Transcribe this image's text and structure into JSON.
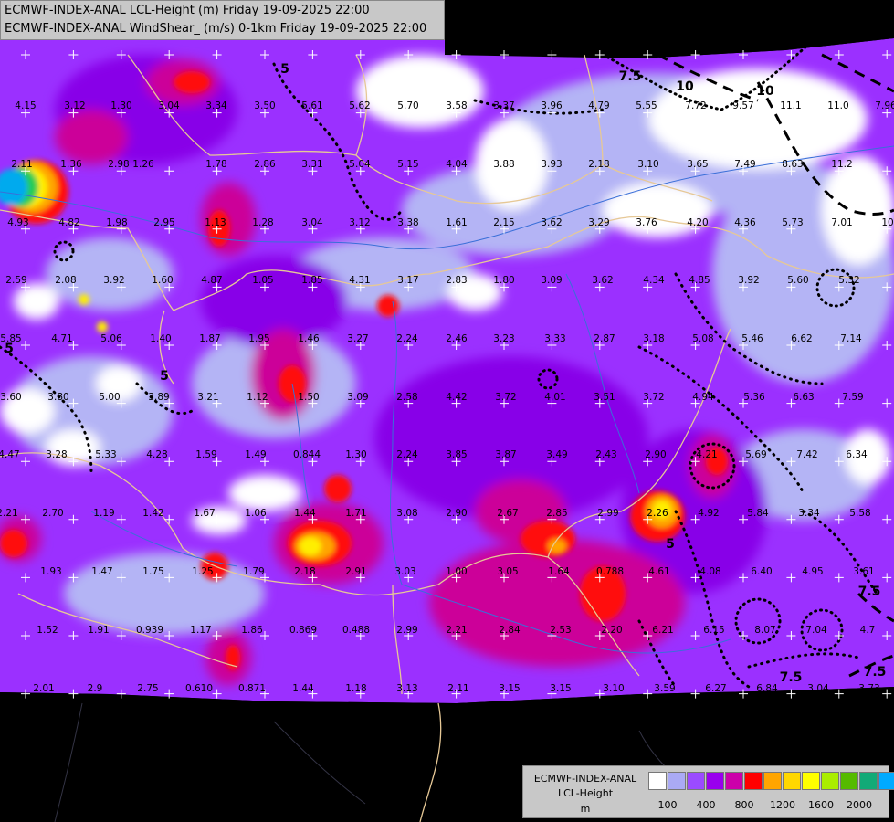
{
  "header": {
    "line1": "ECMWF-INDEX-ANAL LCL-Height (m) Friday 19-09-2025 22:00",
    "line2": "ECMWF-INDEX-ANAL WindShear_ (m/s) 0-1km Friday 19-09-2025 22:00"
  },
  "legend": {
    "title1": "ECMWF-INDEX-ANAL",
    "title2": "LCL-Height",
    "title3": "m",
    "colors": [
      "#ffffff",
      "#aaaaf5",
      "#9b4bff",
      "#9900ee",
      "#cc00aa",
      "#ff0000",
      "#ffa500",
      "#ffd700",
      "#ffff00",
      "#aaee00",
      "#55bb00",
      "#11aa77",
      "#00aaff"
    ],
    "ticks": [
      "100",
      "400",
      "800",
      "1200",
      "1600",
      "2000"
    ]
  },
  "palette": {
    "background": "#000000",
    "base_field": "#9b30ff",
    "low": "#ffffff",
    "light": "#b4b4f5",
    "medium": "#c3a0ff",
    "dark": "#8800e8",
    "magenta": "#cc0099",
    "red": "#ff1010",
    "orange": "#ffa500",
    "yellow": "#ffee00",
    "green": "#22cc55",
    "cyan": "#00aaee",
    "border": "#e6c896",
    "river": "#3a6fd8"
  },
  "contour_labels": [
    "7.5",
    "10",
    "10",
    "5",
    "5",
    "5",
    "7.5",
    "7.5",
    "5",
    "7.5"
  ],
  "values": [
    "4.15",
    "3.12",
    "1.30",
    "3.04",
    "3.34",
    "3.50",
    "5.61",
    "5.62",
    "5.70",
    "3.58",
    "3.37",
    "3.96",
    "4.79",
    "5.55",
    "7.72",
    "9.57",
    "11.1",
    "11.0",
    "7.96",
    "2.11",
    "1.36",
    "2.98",
    "1.26",
    "1.78",
    "2.86",
    "3.31",
    "5.04",
    "5.15",
    "4.04",
    "3.88",
    "3.93",
    "2.18",
    "3.10",
    "3.65",
    "7.49",
    "8.63",
    "11.2",
    "4.93",
    "4.82",
    "1.98",
    "2.95",
    "1.13",
    "1.28",
    "3.04",
    "3.12",
    "3.38",
    "1.61",
    "2.15",
    "3.62",
    "3.29",
    "3.76",
    "4.20",
    "4.36",
    "5.73",
    "7.01",
    "10",
    "2.59",
    "2.08",
    "3.92",
    "1.60",
    "4.87",
    "1.05",
    "1.85",
    "4.31",
    "3.17",
    "2.83",
    "1.80",
    "3.09",
    "3.62",
    "4.34",
    "4.85",
    "3.92",
    "5.60",
    "5.32",
    "5.85",
    "4.71",
    "5.06",
    "1.40",
    "1.87",
    "1.95",
    "1.46",
    "3.27",
    "2.24",
    "2.46",
    "3.23",
    "3.33",
    "2.87",
    "3.18",
    "5.08",
    "5.46",
    "6.62",
    "7.14",
    "3.60",
    "3.80",
    "5.00",
    "3.89",
    "3.21",
    "1.12",
    "1.50",
    "3.09",
    "2.58",
    "4.42",
    "3.72",
    "4.01",
    "3.51",
    "3.72",
    "4.94",
    "5.36",
    "6.63",
    "7.59",
    "4.47",
    "3.28",
    "5.33",
    "4.28",
    "1.59",
    "1.49",
    "0.844",
    "1.30",
    "2.24",
    "3.85",
    "3.87",
    "3.49",
    "2.43",
    "2.90",
    "4.21",
    "5.69",
    "7.42",
    "6.34",
    "2.21",
    "2.70",
    "1.19",
    "1.42",
    "1.67",
    "1.06",
    "1.44",
    "1.71",
    "3.08",
    "2.90",
    "2.67",
    "2.85",
    "2.99",
    "2.26",
    "4.92",
    "5.84",
    "3.34",
    "5.58",
    "1.93",
    "1.47",
    "1.75",
    "1.25",
    "1.79",
    "2.18",
    "2.91",
    "3.03",
    "1.00",
    "3.05",
    "1.64",
    "0.788",
    "4.61",
    "4.08",
    "6.40",
    "4.95",
    "3.61",
    "1.52",
    "1.91",
    "0.939",
    "1.17",
    "1.86",
    "0.869",
    "0.488",
    "2.99",
    "2.21",
    "2.84",
    "2.53",
    "2.20",
    "6.21",
    "6.15",
    "8.07",
    "7.04",
    "4.7",
    "2.01",
    "2.9",
    "2.75",
    "0.610",
    "0.871",
    "1.44",
    "1.18",
    "3.13",
    "2.11",
    "3.15",
    "3.15",
    "3.10",
    "3.59",
    "6.27",
    "6.84",
    "3.04",
    "3.73"
  ]
}
